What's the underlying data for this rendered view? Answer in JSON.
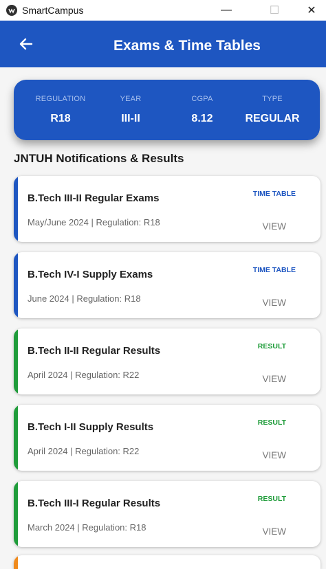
{
  "window": {
    "title": "SmartCampus",
    "minimize": "—",
    "maximize": "☐",
    "close": "✕"
  },
  "appbar": {
    "title": "Exams & Time Tables",
    "back_icon": "arrow-left-icon",
    "color": "#1e56c1"
  },
  "summary": {
    "regulation": {
      "label": "REGULATION",
      "value": "R18"
    },
    "year": {
      "label": "YEAR",
      "value": "III-II"
    },
    "cgpa": {
      "label": "CGPA",
      "value": "8.12"
    },
    "type": {
      "label": "TYPE",
      "value": "REGULAR"
    }
  },
  "section_title": "JNTUH Notifications & Results",
  "colors": {
    "timetable_accent": "#1e56c1",
    "result_accent": "#1f9c3a",
    "peek_accent": "#f08a1c"
  },
  "cards": [
    {
      "title": "B.Tech III-II Regular Exams",
      "subtitle": "May/June 2024 | Regulation: R18",
      "type": "TIME TABLE",
      "action": "VIEW"
    },
    {
      "title": "B.Tech IV-I Supply Exams",
      "subtitle": "June 2024 | Regulation: R18",
      "type": "TIME TABLE",
      "action": "VIEW"
    },
    {
      "title": "B.Tech II-II Regular Results",
      "subtitle": "April 2024 | Regulation: R22",
      "type": "RESULT",
      "action": "VIEW"
    },
    {
      "title": "B.Tech I-II Supply Results",
      "subtitle": "April 2024 | Regulation: R22",
      "type": "RESULT",
      "action": "VIEW"
    },
    {
      "title": "B.Tech III-I Regular Results",
      "subtitle": "March 2024 | Regulation: R18",
      "type": "RESULT",
      "action": "VIEW"
    }
  ]
}
